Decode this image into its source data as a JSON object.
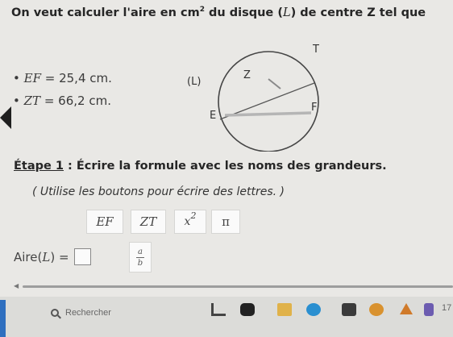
{
  "problem": {
    "title_before": "On veut calculer l'aire en ",
    "unit_cm": "cm",
    "unit_exp": "2",
    "title_mid": " du disque (",
    "disk_var": "L",
    "title_after": ") de centre Z tel que",
    "given": [
      {
        "var": "EF",
        "eq": " = 25,4 cm."
      },
      {
        "var": "ZT",
        "eq": " = 66,2 cm."
      }
    ]
  },
  "figure": {
    "label_L": "(L)",
    "label_T": "T",
    "label_Z": "Z",
    "label_E": "E",
    "label_F": "F",
    "circle_color": "#454545"
  },
  "step": {
    "label": "Étape 1",
    "text": " : Écrire la formule avec les noms des grandeurs."
  },
  "hint": "( Utilise les boutons pour écrire des lettres. )",
  "tokens": {
    "ef": "EF",
    "zt": "ZT",
    "x": "x",
    "exp": "2",
    "pi": "π"
  },
  "answer": {
    "prefix": "Aire(",
    "var": "L",
    "suffix": ") =",
    "frac_num": "a",
    "frac_den": "b"
  },
  "taskbar": {
    "search_placeholder": "Rechercher",
    "clipped_text": "17",
    "accent": "#2f6fbf"
  }
}
